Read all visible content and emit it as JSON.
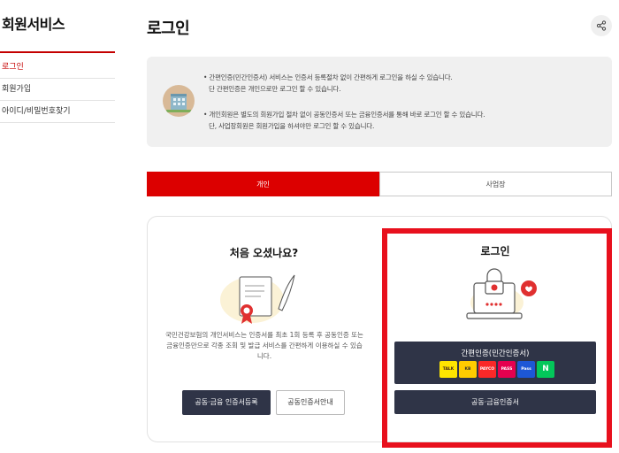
{
  "sidebar": {
    "title": "회원서비스",
    "items": [
      {
        "label": "로그인"
      },
      {
        "label": "회원가입"
      },
      {
        "label": "아이디/비밀번호찾기"
      }
    ]
  },
  "header": {
    "title": "로그인",
    "share_icon": "share-icon"
  },
  "info": {
    "lines": [
      "• 간편인증(민간인증서) 서비스는 인증서 등록절차 없이 간편하게 로그인을 하실 수 있습니다.",
      "단 간편인증은 개인으로만 로그인 할 수 있습니다.",
      "• 개인회원은 별도의 회원가입 절차 없이 공동인증서 또는 금융인증서를 통해 바로 로그인 할 수 있습니다.",
      "단, 사업장회원은 회원가입을 하셔야만 로그인 할 수 있습니다."
    ]
  },
  "tabs": [
    {
      "label": "개인",
      "active": true
    },
    {
      "label": "사업장",
      "active": false
    }
  ],
  "new_user": {
    "title": "처음 오셨나요?",
    "description": "국민건강보험의 개인서비스는 인증서를 최초 1회 등록 후 공동인증 또는 금융인증만으로 각종 조회 및 발급 서비스를 간편하게 이용하실 수 있습니다.",
    "register_button": "공동·금융 인증서등록",
    "guide_button": "공동인증서안내"
  },
  "login": {
    "title": "로그인",
    "simple_auth_button": "간편인증(민간인증서)",
    "cert_providers": [
      {
        "label": "TALK",
        "bg": "#fee500",
        "fg": "#3a1d1d"
      },
      {
        "label": "KB",
        "bg": "#ffcc00",
        "fg": "#333333"
      },
      {
        "label": "PAYCO",
        "bg": "#fa2828",
        "fg": "#ffffff"
      },
      {
        "label": "PASS",
        "bg": "#e5004f",
        "fg": "#ffffff"
      },
      {
        "label": "Pass",
        "bg": "#1d57d6",
        "fg": "#ffffff"
      },
      {
        "label": "N",
        "bg": "#03c75a",
        "fg": "#ffffff"
      }
    ],
    "fin_cert_button": "공동·금융인증서"
  },
  "colors": {
    "brand_red": "#dc0000",
    "highlight": "#e8101d",
    "button_dark": "#2f3447"
  }
}
